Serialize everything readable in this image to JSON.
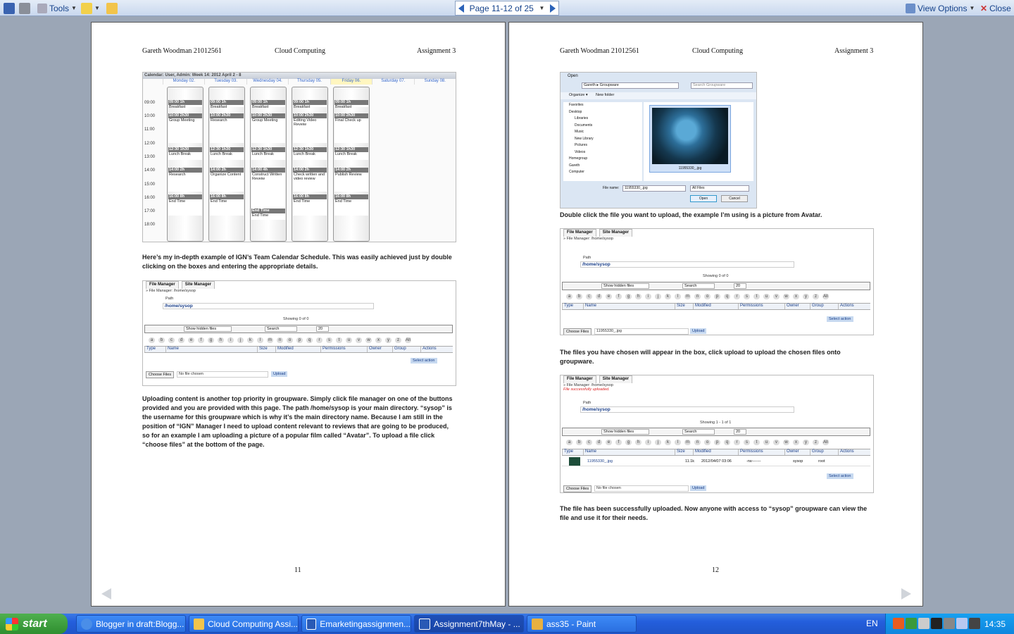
{
  "toolbar": {
    "tools_label": "Tools",
    "page_indicator": "Page 11-12 of 25",
    "view_options_label": "View Options",
    "close_label": "Close"
  },
  "pages": {
    "left": {
      "header_left": "Gareth Woodman 21012561",
      "header_center": "Cloud Computing",
      "header_right": "Assignment 3",
      "calendar": {
        "title": "Calendar: User, Admin: Week 14: 2012 April 2 - 8",
        "days": [
          "Monday 02.",
          "Tuesday 03.",
          "Wednesday 04.",
          "Thursday 05.",
          "Friday 06.",
          "Saturday 07.",
          "Sunday 08."
        ],
        "times": [
          "09:00",
          "10:00",
          "11:00",
          "12:00",
          "13:00",
          "14:00",
          "15:00",
          "16:00",
          "17:00",
          "18:00"
        ],
        "columns": [
          {
            "events": [
              {
                "head": "09:00 1h",
                "text": "Breakfast"
              },
              {
                "head": "10:00 2h30",
                "text": "Group Meeting"
              },
              {
                "head": "12:30 1h30",
                "text": "Lunch Break"
              },
              {
                "head": "14:00 2h",
                "text": "Research"
              },
              {
                "head": "16:00 8h",
                "text": "End Time"
              }
            ]
          },
          {
            "events": [
              {
                "head": "09:00 1h",
                "text": "Breakfast"
              },
              {
                "head": "10:00 2h30",
                "text": "Research"
              },
              {
                "head": "12:30 1h30",
                "text": "Lunch Break"
              },
              {
                "head": "14:00 2h",
                "text": "Organize Content"
              },
              {
                "head": "16:00 8h",
                "text": "End Time"
              }
            ]
          },
          {
            "events": [
              {
                "head": "09:00 1h",
                "text": "Breakfast"
              },
              {
                "head": "10:00 2h30",
                "text": "Group Meeting"
              },
              {
                "head": "12:30 1h30",
                "text": "Lunch Break"
              },
              {
                "head": "14:00 4h",
                "text": "Construct Written Reveiw"
              },
              {
                "head": "End Time",
                "text": "End Time"
              }
            ]
          },
          {
            "events": [
              {
                "head": "09:00 1h",
                "text": "Breakfast"
              },
              {
                "head": "10:00 2h30",
                "text": "Editing Video Reveiw"
              },
              {
                "head": "12:30 1h30",
                "text": "Lunch Break"
              },
              {
                "head": "14:00 2h",
                "text": "Check written and video review"
              },
              {
                "head": "16:00 8h",
                "text": "End Time"
              }
            ]
          },
          {
            "events": [
              {
                "head": "09:00 1h",
                "text": "Breakfast"
              },
              {
                "head": "10:00 2h30",
                "text": "Final Check up"
              },
              {
                "head": "12:30 1h30",
                "text": "Lunch Break"
              },
              {
                "head": "14:00 2h",
                "text": "Publish Review"
              },
              {
                "head": "16:00 8h",
                "text": "End Time"
              }
            ]
          }
        ]
      },
      "para1": "Here’s my in-depth example of IGN’s Team Calendar Schedule. This was easily achieved just by double clicking on the boxes and entering the appropriate details.",
      "para2": "Uploading content is another top priority in groupware. Simply click file manager on one of the buttons provided and you are provided with this page. The path /home/sysop is your main directory. “sysop” is the username for this groupware which is why it’s the main directory name. Because I am still in the position of “IGN” Manager I need to upload content relevant to reviews that are going to be produced, so for an example I am uploading a picture of a popular film called “Avatar”. To upload a file click “choose files” at the bottom of the page.",
      "page_number": "11"
    },
    "right": {
      "header_left": "Gareth Woodman 21012561",
      "header_center": "Cloud Computing",
      "header_right": "Assignment 3",
      "para1": "Double click the file you want to upload, the example I’m using is a picture from Avatar.",
      "para2": "The files you have chosen will appear in the box, click upload to upload the chosen files onto groupware.",
      "para3": "The file has been successfully uploaded. Now anyone with access to “sysop” groupware can view the file and use it for their needs.",
      "page_number": "12",
      "open_dialog": {
        "title": "Open",
        "crumb": "Gareth ▸ Groupware",
        "search": "Search Groupware",
        "organize": "Organize ▾",
        "new_folder": "New folder",
        "tree": [
          "Favorites",
          "Desktop",
          "Libraries",
          "Documents",
          "Music",
          "New Library",
          "Pictures",
          "Videos",
          "Homegroup",
          "Gareth",
          "Computer"
        ],
        "file_caption": "11955330_.jpg",
        "file_name_label": "File name:",
        "file_name_value": "11955330_.jpg",
        "file_type": "All Files",
        "open_btn": "Open",
        "cancel_btn": "Cancel"
      }
    }
  },
  "file_manager": {
    "tab_file": "File Manager",
    "tab_site": "Site Manager",
    "crumb": "» File Manager: /home/sysop",
    "path_label": "Path",
    "path": "/home/sysop",
    "showing_empty": "Showing 0 of 0",
    "showing_one": "Showing 1 - 1 of 1",
    "hidden_files": "Show hidden files",
    "search": "Search",
    "per_page": "20",
    "letters": [
      "a",
      "b",
      "c",
      "d",
      "e",
      "f",
      "g",
      "h",
      "i",
      "j",
      "k",
      "l",
      "m",
      "n",
      "o",
      "p",
      "q",
      "r",
      "s",
      "t",
      "u",
      "v",
      "w",
      "x",
      "y",
      "z",
      "All"
    ],
    "cols": [
      "Type",
      "Name",
      "Size",
      "Modified",
      "Permissions",
      "Owner",
      "Group",
      "Actions"
    ],
    "select_action": "Select action",
    "choose_files": "Choose Files",
    "no_file": "No file chosen",
    "chosen_file": "11955330_.jpg",
    "upload": "Upload",
    "success": "File successfully uploaded.",
    "row": {
      "name": "11955330_.jpg",
      "size": "11.1k",
      "modified": "2012/04/07 03:06",
      "perms": "-rw-------",
      "owner": "sysop",
      "group": "root"
    }
  },
  "taskbar": {
    "start": "start",
    "tasks": [
      "Blogger in draft:Blogg...",
      "Cloud Computing Assi...",
      "Emarketingassignmen...",
      "Assignment7thMay - ...",
      "ass35 - Paint"
    ],
    "lang": "EN",
    "clock": "14:35"
  }
}
